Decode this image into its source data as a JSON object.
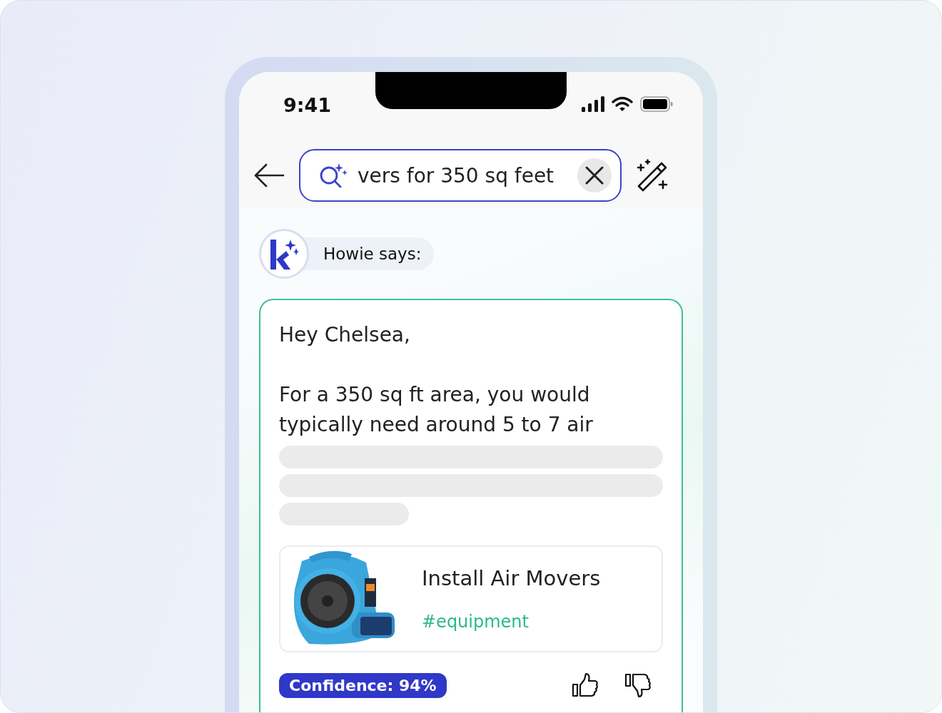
{
  "status_bar": {
    "time": "9:41"
  },
  "search": {
    "value": "vers for 350 sq feet"
  },
  "assistant": {
    "label": "Howie says:"
  },
  "response": {
    "greeting": "Hey Chelsea,",
    "body": "For a 350 sq ft area, you would typically need around 5 to 7 air",
    "loading": true,
    "task": {
      "kind": "picture",
      "title": "Install Air Movers",
      "tag": "#equipment"
    },
    "confidence": "Confidence: 94%"
  }
}
